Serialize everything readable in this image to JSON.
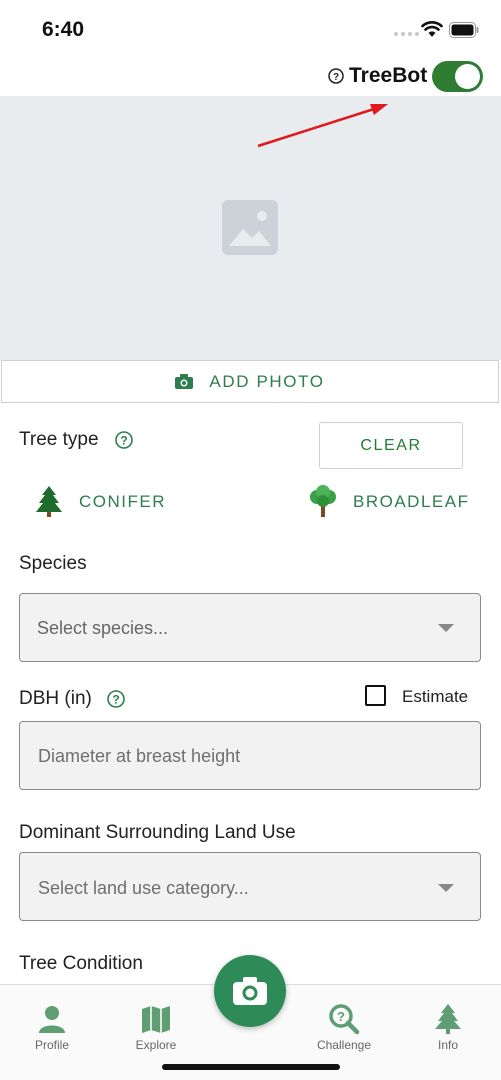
{
  "status_bar": {
    "time": "6:40"
  },
  "header": {
    "treebot_label": "TreeBot",
    "treebot_enabled": true
  },
  "photo": {
    "add_photo_label": "ADD PHOTO"
  },
  "tree_type": {
    "label": "Tree type",
    "clear_label": "CLEAR",
    "options": [
      {
        "label": "CONIFER",
        "icon": "conifer-icon"
      },
      {
        "label": "BROADLEAF",
        "icon": "broadleaf-icon"
      }
    ]
  },
  "species": {
    "label": "Species",
    "placeholder": "Select species..."
  },
  "dbh": {
    "label": "DBH (in)",
    "estimate_label": "Estimate",
    "estimate_checked": false,
    "placeholder": "Diameter at breast height"
  },
  "land_use": {
    "label": "Dominant Surrounding Land Use",
    "placeholder": "Select land use category..."
  },
  "tree_condition": {
    "label": "Tree Condition"
  },
  "nav": {
    "items": [
      {
        "label": "Profile",
        "icon": "profile-icon"
      },
      {
        "label": "Explore",
        "icon": "map-icon"
      },
      {
        "label": "Challenge",
        "icon": "challenge-icon"
      },
      {
        "label": "Info",
        "icon": "info-tree-icon"
      }
    ],
    "camera_icon": "camera-icon"
  },
  "colors": {
    "accent": "#2e7d32",
    "brand_green": "#2e8b57",
    "photo_bg": "#e9ecef",
    "arrow": "#e0191c"
  }
}
